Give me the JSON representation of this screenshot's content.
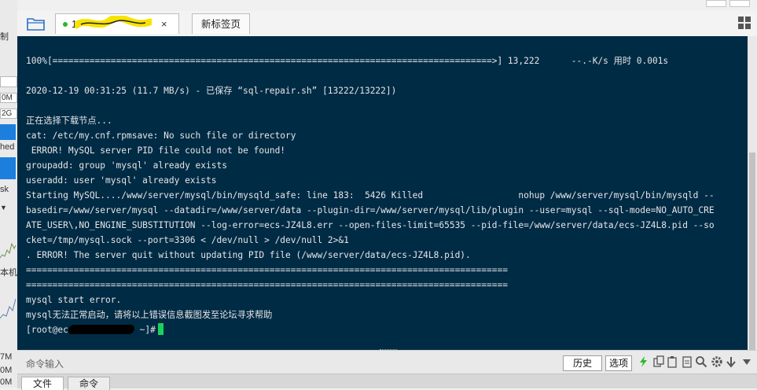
{
  "left_strip": {
    "texts": [
      "制",
      "0M",
      "2G",
      "hed",
      "sk",
      "本机",
      "7M",
      "0M",
      "0M"
    ]
  },
  "tabs": [
    {
      "label": "1",
      "active": true,
      "close": "×"
    },
    {
      "label": "新标签页",
      "active": false
    }
  ],
  "terminal": {
    "lines": [
      "100%[===================================================================================>] 13,222      --.-K/s 用时 0.001s",
      "",
      "2020-12-19 00:31:25 (11.7 MB/s) - 已保存 “sql-repair.sh” [13222/13222])",
      "",
      "正在选择下载节点...",
      "cat: /etc/my.cnf.rpmsave: No such file or directory",
      " ERROR! MySQL server PID file could not be found!",
      "groupadd: group 'mysql' already exists",
      "useradd: user 'mysql' already exists",
      "Starting MySQL..../www/server/mysql/bin/mysqld_safe: line 183:  5426 Killed                  nohup /www/server/mysql/bin/mysqld --",
      "basedir=/www/server/mysql --datadir=/www/server/data --plugin-dir=/www/server/mysql/lib/plugin --user=mysql --sql-mode=NO_AUTO_CRE",
      "ATE_USER\\,NO_ENGINE_SUBSTITUTION --log-error=ecs-JZ4L8.err --open-files-limit=65535 --pid-file=/www/server/data/ecs-JZ4L8.pid --so",
      "cket=/tmp/mysql.sock --port=3306 < /dev/null > /dev/null 2>&1",
      ". ERROR! The server quit without updating PID file (/www/server/data/ecs-JZ4L8.pid).",
      "===========================================================================================",
      "===========================================================================================",
      "mysql start error.",
      "mysql无法正常启动，请将以上错误信息截图发至论坛寻求帮助"
    ],
    "prompt_prefix": "[root@ec",
    "prompt_suffix": " ~]#"
  },
  "command_bar": {
    "placeholder": "命令输入",
    "history_label": "历史",
    "options_label": "选项"
  },
  "bottom_tabs": [
    "文件",
    "命令"
  ],
  "colors": {
    "terminal_bg": "#002b45",
    "terminal_fg": "#e6e6e6",
    "cursor": "#19d35a",
    "accent_blue": "#1d7fdd"
  }
}
